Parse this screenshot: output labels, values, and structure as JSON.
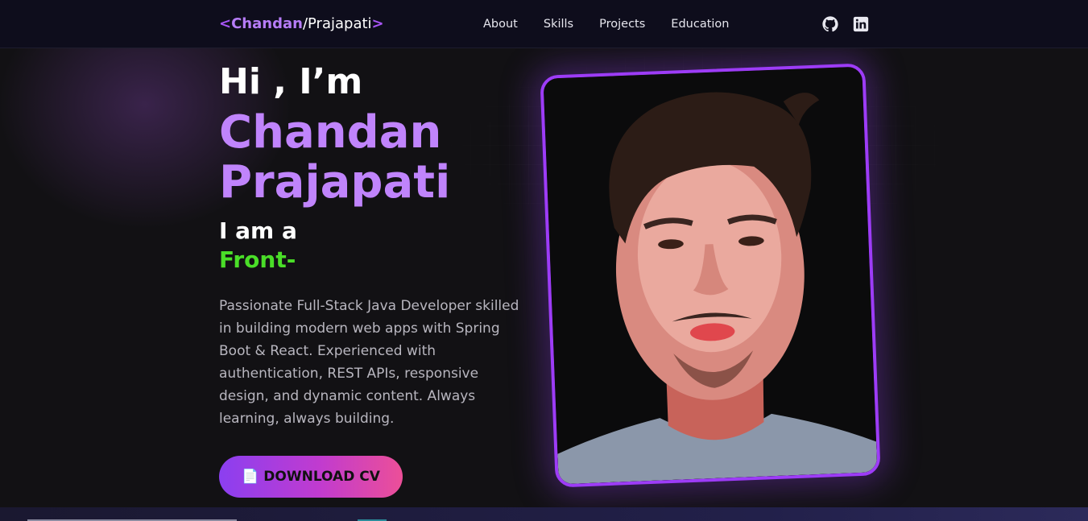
{
  "nav": {
    "logo": {
      "open": "<",
      "first": "Chandan",
      "slash": "/",
      "last": "Prajapati",
      "close": ">"
    },
    "links": [
      "About",
      "Skills",
      "Projects",
      "Education"
    ],
    "icons": [
      "github-icon",
      "linkedin-icon"
    ]
  },
  "hero": {
    "greeting": "Hi , I’m",
    "name_line1": "Chandan",
    "name_line2": "Prajapati",
    "iam": "I am a",
    "role": "Front-",
    "bio": "Passionate Full-Stack Java Developer skilled in building modern web apps with Spring Boot & React. Experienced with authentication, REST APIs, responsive design, and dynamic content. Always learning, always building.",
    "cv_icon": "📄",
    "cv_label": "DOWNLOAD CV"
  },
  "colors": {
    "accent": "#c084fc",
    "role_green": "#4ade28",
    "frame": "#9d3cf7",
    "bg": "#121114",
    "nav_bg": "#0e0d1c"
  }
}
